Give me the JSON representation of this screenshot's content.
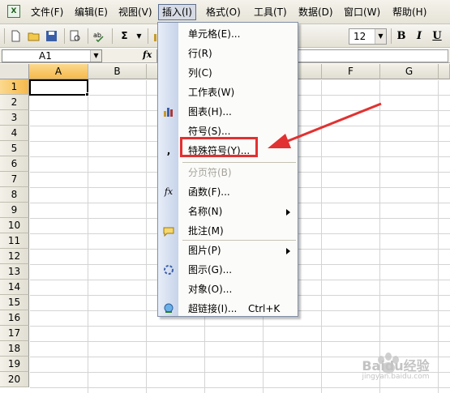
{
  "menubar": {
    "items": [
      {
        "label": "文件(F)"
      },
      {
        "label": "编辑(E)"
      },
      {
        "label": "视图(V)"
      },
      {
        "label": "插入(I)",
        "active": true
      },
      {
        "label": "格式(O)"
      },
      {
        "label": "工具(T)"
      },
      {
        "label": "数据(D)"
      },
      {
        "label": "窗口(W)"
      },
      {
        "label": "帮助(H)"
      }
    ]
  },
  "toolbar": {
    "font_size": "12",
    "bold": "B",
    "italic": "I",
    "underline": "U",
    "sum": "Σ"
  },
  "formula_bar": {
    "name_box": "A1",
    "fx_label": "fx",
    "value": ""
  },
  "sheet": {
    "columns": [
      "A",
      "B",
      "F",
      "G"
    ],
    "rows": [
      "1",
      "2",
      "3",
      "4",
      "5",
      "6",
      "7",
      "8",
      "9",
      "10",
      "11",
      "12",
      "13",
      "14",
      "15",
      "16",
      "17",
      "18",
      "19",
      "20"
    ],
    "active_cell": "A1"
  },
  "insert_menu": {
    "items": [
      {
        "label": "单元格(E)...",
        "icon": "none"
      },
      {
        "label": "行(R)",
        "icon": "none"
      },
      {
        "label": "列(C)",
        "icon": "none"
      },
      {
        "label": "工作表(W)",
        "icon": "none"
      },
      {
        "label": "图表(H)...",
        "icon": "chart-icon"
      },
      {
        "label": "符号(S)...",
        "icon": "none"
      },
      {
        "label": "特殊符号(Y)...",
        "icon": "special-symbol-icon",
        "highlighted": true
      },
      {
        "label": "分页符(B)",
        "icon": "none",
        "disabled": true
      },
      {
        "label": "函数(F)...",
        "icon": "function-icon"
      },
      {
        "label": "名称(N)",
        "icon": "none",
        "submenu": true
      },
      {
        "label": "批注(M)",
        "icon": "comment-icon"
      },
      {
        "label": "图片(P)",
        "icon": "picture-icon",
        "submenu": true
      },
      {
        "label": "图示(G)...",
        "icon": "diagram-icon"
      },
      {
        "label": "对象(O)...",
        "icon": "none"
      },
      {
        "label": "超链接(I)...",
        "icon": "hyperlink-icon",
        "shortcut": "Ctrl+K"
      }
    ]
  },
  "annotation": {
    "color": "#e23131"
  },
  "watermark": {
    "text": "Baidu经验",
    "sub": "jingyan.baidu.com"
  }
}
